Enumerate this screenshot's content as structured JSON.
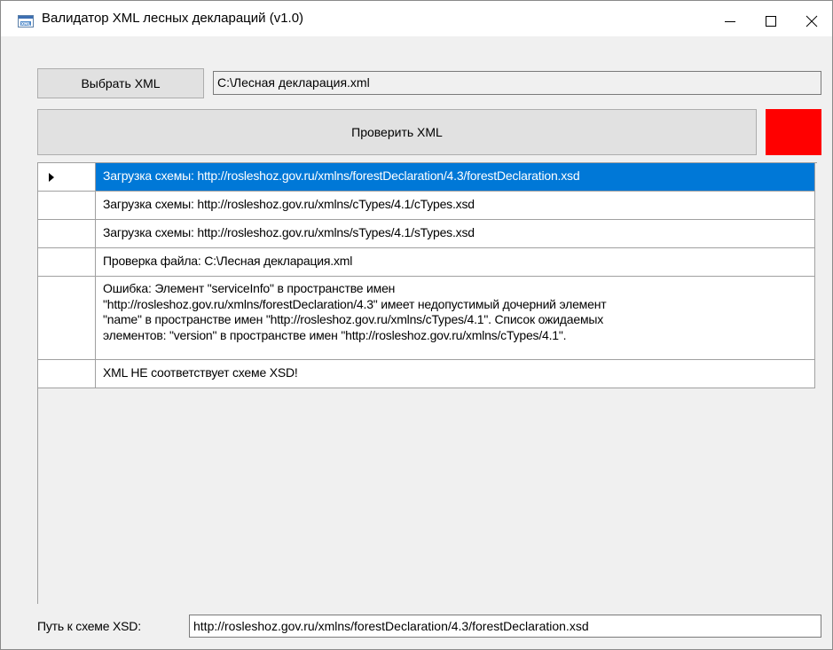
{
  "window": {
    "title": "Валидатор XML лесных деклараций (v1.0)",
    "icon": "xml-file-icon",
    "controls": [
      "minimize-icon",
      "maximize-icon",
      "close-icon"
    ]
  },
  "toolbar": {
    "select_button_label": "Выбрать XML",
    "file_path_value": "C:\\Лесная декларация.xml",
    "validate_button_label": "Проверить XML",
    "status_indicator_color": "#ff0000"
  },
  "log": {
    "rows": [
      {
        "text": "Загрузка схемы: http://rosleshoz.gov.ru/xmlns/forestDeclaration/4.3/forestDeclaration.xsd",
        "selected": true
      },
      {
        "text": "Загрузка схемы: http://rosleshoz.gov.ru/xmlns/cTypes/4.1/cTypes.xsd",
        "selected": false
      },
      {
        "text": "Загрузка схемы: http://rosleshoz.gov.ru/xmlns/sTypes/4.1/sTypes.xsd",
        "selected": false
      },
      {
        "text": "Проверка файла: C:\\Лесная декларация.xml",
        "selected": false
      },
      {
        "text": "Ошибка: Элемент \"serviceInfo\" в пространстве имен\n\"http://rosleshoz.gov.ru/xmlns/forestDeclaration/4.3\" имеет недопустимый дочерний элемент\n\"name\" в пространстве имен \"http://rosleshoz.gov.ru/xmlns/cTypes/4.1\". Список ожидаемых\nэлементов: \"version\" в пространстве имен \"http://rosleshoz.gov.ru/xmlns/cTypes/4.1\".",
        "selected": false
      },
      {
        "text": "XML НЕ соответствует схеме XSD!",
        "selected": false
      }
    ],
    "selection_color": "#0078d7"
  },
  "footer": {
    "xsd_label": "Путь к схеме XSD:",
    "xsd_path_value": "http://rosleshoz.gov.ru/xmlns/forestDeclaration/4.3/forestDeclaration.xsd"
  }
}
